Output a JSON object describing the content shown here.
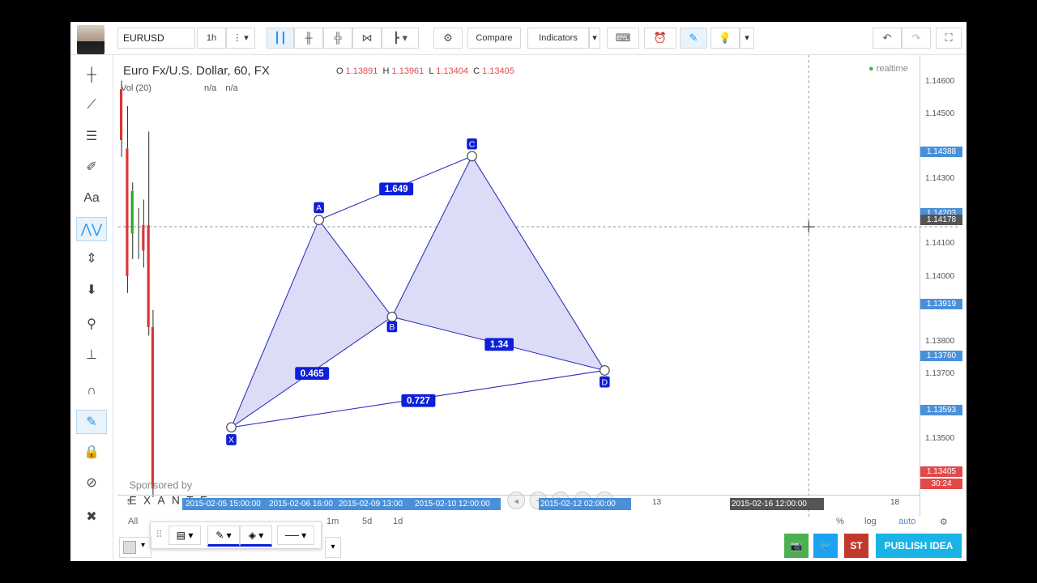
{
  "toolbar": {
    "symbol": "EURUSD",
    "interval": "1h",
    "compare_label": "Compare",
    "indicators_label": "Indicators"
  },
  "legend": {
    "title": "Euro Fx/U.S. Dollar, 60, FX",
    "o_label": "O",
    "o_value": "1.13891",
    "h_label": "H",
    "h_value": "1.13961",
    "l_label": "L",
    "l_value": "1.13404",
    "c_label": "C",
    "c_value": "1.13405",
    "volume_label": "Vol (20)",
    "vol_val1": "n/a",
    "vol_val2": "n/a",
    "realtime": "realtime"
  },
  "price_scale": {
    "ticks": [
      "1.14600",
      "1.14500",
      "1.14300",
      "1.14100",
      "1.14000",
      "1.13800",
      "1.13700",
      "1.13500"
    ],
    "labels": [
      {
        "text": "1.14388",
        "color": "#4a90d9"
      },
      {
        "text": "1.14203",
        "color": "#4a90d9"
      },
      {
        "text": "1.14178",
        "color": "#555555"
      },
      {
        "text": "1.13919",
        "color": "#4a90d9"
      },
      {
        "text": "1.13760",
        "color": "#4a90d9"
      },
      {
        "text": "1.13593",
        "color": "#4a90d9"
      },
      {
        "text": "1.13405",
        "color": "#e04a4a"
      },
      {
        "text": "30:24",
        "color": "#e04a4a"
      }
    ]
  },
  "time_scale": {
    "ticks": [
      "5",
      "13",
      "18"
    ],
    "labels": [
      "2015-02-05 15:00:00",
      "2015-02-06 16:00",
      "2015-02-09 13:00",
      "2015-02-10 12:00:00",
      "2015-02-12 02:00:00",
      "2015-02-16 12:00:00"
    ]
  },
  "pattern": {
    "points": [
      "X",
      "A",
      "B",
      "C",
      "D"
    ],
    "ratios": [
      "1.649",
      "0.465",
      "1.34",
      "0.727"
    ],
    "fill_color": "#dcdcf7",
    "line_color": "#2b2bbd",
    "label_bg": "#0d1fd9"
  },
  "sponsor": {
    "prefix": "Sponsored by",
    "name": "EXANTE"
  },
  "bottom_bar": {
    "ranges": [
      "All",
      "1m",
      "5d",
      "1d"
    ],
    "percent": "%",
    "log": "log",
    "auto": "auto"
  },
  "footer": {
    "publish_label": "PUBLISH IDEA",
    "st_label": "ST",
    "camera_color": "#4caf50",
    "twitter_color": "#1da1f2",
    "st_color": "#c0392b",
    "publish_color": "#1ab3e6"
  }
}
